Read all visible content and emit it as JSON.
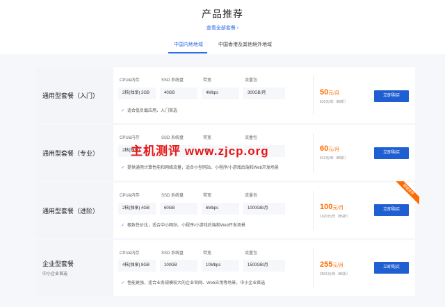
{
  "header": {
    "title": "产品推荐",
    "view_all_link": "查看全部套餐 ›"
  },
  "tabs": [
    {
      "label": "中国内地地域",
      "active": true
    },
    {
      "label": "中国香港及其他境外地域",
      "active": false
    }
  ],
  "spec_headers": [
    "CPU&内存",
    "SSD 系统盘",
    "带宽",
    "流量包"
  ],
  "plans": [
    {
      "name": "通用型套餐（入门）",
      "subtitle": "",
      "specs": [
        "2核(独享) 2GB",
        "40GB",
        "4Mbps",
        "300GB/月"
      ],
      "feature": "适合低负载应用、入门首选",
      "price": "50",
      "price_unit": "元/月",
      "price_year": "510元/年（85折）",
      "buy_label": "立即购买",
      "badge": ""
    },
    {
      "name": "通用型套餐（专业）",
      "subtitle": "",
      "specs": [
        "2核(独享)",
        "",
        "5",
        ""
      ],
      "feature": "提供通用计算性能和网络流量，适合小型网站、小程序/小游戏后端和Web开发场景",
      "price": "60",
      "price_unit": "元/月",
      "price_year": "612元/年（85折）",
      "buy_label": "立即购买",
      "badge": ""
    },
    {
      "name": "通用型套餐（进阶）",
      "subtitle": "",
      "specs": [
        "2核(独享) 4GB",
        "60GB",
        "6Mbps",
        "1000GB/月"
      ],
      "feature": "极致性价比，适合中小网站、小程序/小游戏后端和Web开发场景",
      "price": "100",
      "price_unit": "元/月",
      "price_year": "1020元/年（85折）",
      "buy_label": "立即购买",
      "badge": "超值推荐"
    },
    {
      "name": "企业型套餐",
      "subtitle": "中小企业首选",
      "specs": [
        "4核(独享) 8GB",
        "100GB",
        "10Mbps",
        "1500GB/月"
      ],
      "feature": "性能更强，适合业务规模较大的企业官网、Web应用等场景，中小企业首选",
      "price": "255",
      "price_unit": "元/月",
      "price_year": "2601元/年（85折）",
      "buy_label": "立即购买",
      "badge": ""
    }
  ],
  "watermark": "主机测评 www.zjcp.org",
  "colors": {
    "accent": "#2b6de8",
    "button": "#1f5fd1",
    "price": "#ff6a00",
    "watermark": "#e81414"
  }
}
